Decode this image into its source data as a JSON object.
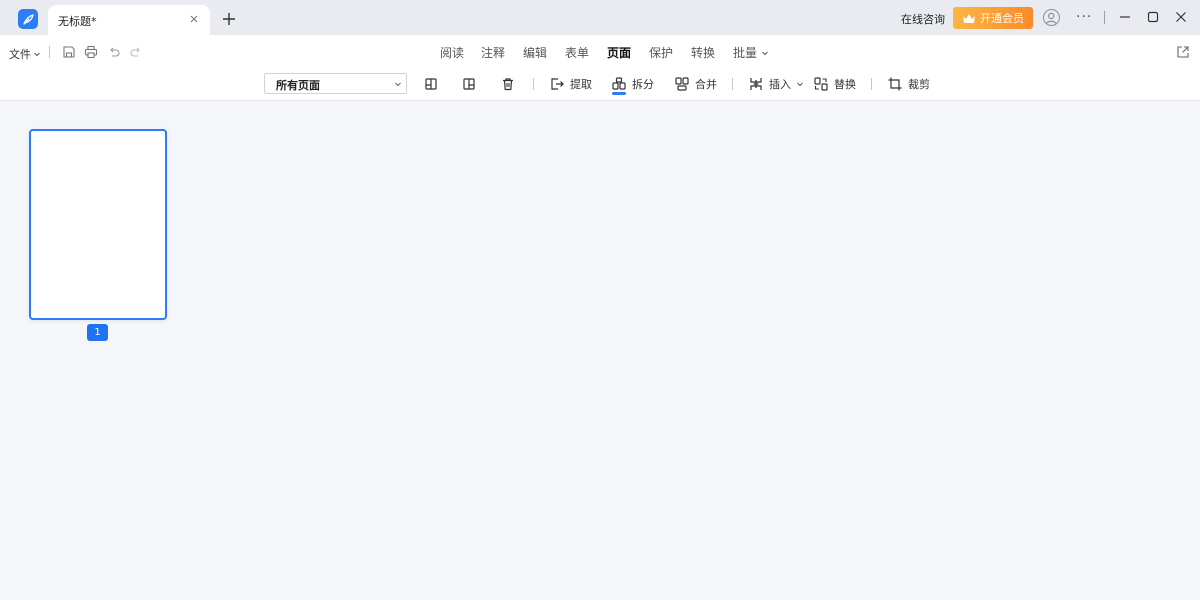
{
  "titlebar": {
    "tab_title": "无标题*",
    "consult_label": "在线咨询",
    "vip_label": "开通会员",
    "more_label": "···"
  },
  "toolbar": {
    "file_label": "文件",
    "main_tabs": [
      {
        "label": "阅读"
      },
      {
        "label": "注释"
      },
      {
        "label": "编辑"
      },
      {
        "label": "表单"
      },
      {
        "label": "页面",
        "active": true
      },
      {
        "label": "保护"
      },
      {
        "label": "转换"
      },
      {
        "label": "批量"
      }
    ],
    "page_select": {
      "value": "所有页面"
    },
    "tools": {
      "extract_label": "提取",
      "split_label": "拆分",
      "merge_label": "合并",
      "insert_label": "插入",
      "replace_label": "替换",
      "crop_label": "裁剪"
    }
  },
  "canvas": {
    "pages": [
      {
        "number": "1",
        "selected": true
      }
    ]
  },
  "colors": {
    "accent": "#2c7df6",
    "vip_gradient_start": "#fbb644",
    "vip_gradient_end": "#fb8a2b",
    "titlebar_bg": "#e9ebf0",
    "canvas_bg": "#f5f6f9"
  },
  "icons": {
    "app_logo": "feather-logo-icon",
    "tab_close": "close-icon",
    "new_tab": "plus-icon",
    "vip": "crown-icon",
    "avatar": "user-avatar-icon",
    "minimize": "minimize-icon",
    "maximize": "maximize-icon",
    "close": "close-window-icon",
    "save": "save-icon",
    "print": "print-icon",
    "undo": "undo-icon",
    "redo": "redo-icon",
    "popout": "open-external-icon"
  }
}
